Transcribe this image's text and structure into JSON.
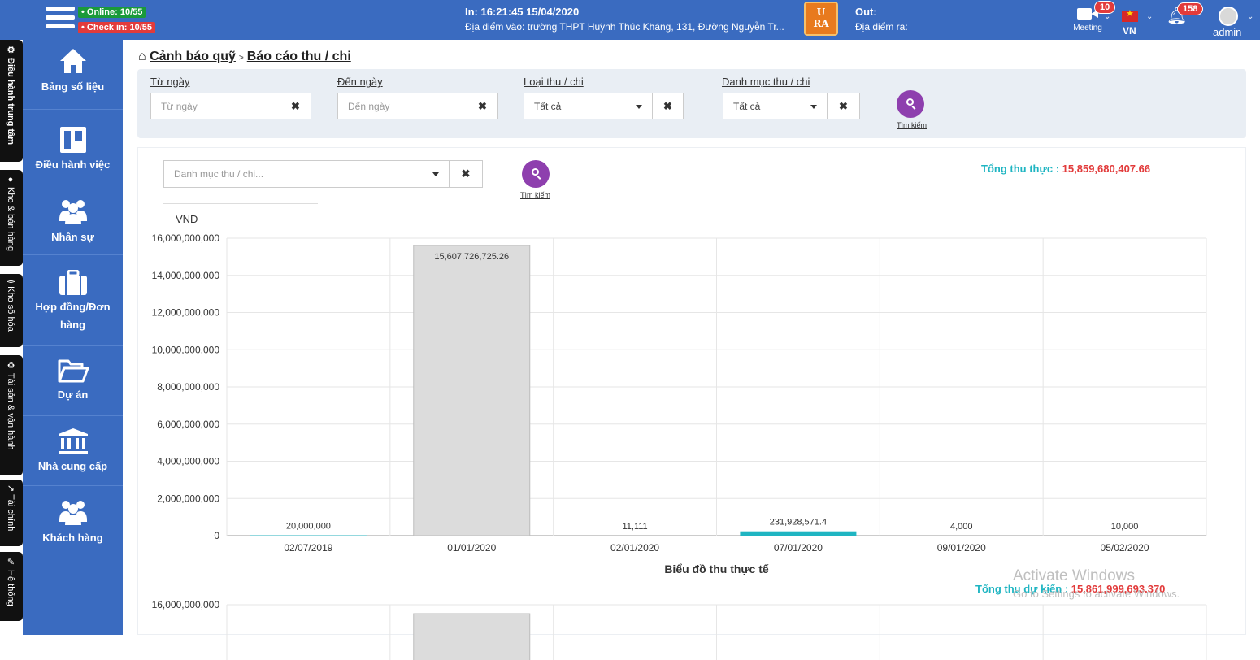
{
  "header": {
    "online": "• Online: 10/55",
    "checkin": "• Check in: 10/55",
    "in_time": "In: 16:21:45 15/04/2020",
    "in_place": "Địa điểm vào: trường THPT Huỳnh Thúc Kháng, 131, Đường Nguyễn Tr...",
    "logo_text_1": "U",
    "logo_text_2": "RA",
    "out_label": "Out:",
    "out_place": "Địa điểm ra:",
    "meeting_label": "Meeting",
    "meeting_badge": "10",
    "lang": "VN",
    "notif_badge": "158",
    "user": "admin",
    "accent": "#3a6bc0"
  },
  "vtabs": [
    {
      "label": "⚙ Điều hành trung tâm",
      "icon": "gear-icon"
    },
    {
      "label": "● Kho & bán hàng",
      "icon": "store-icon"
    },
    {
      "label": "⟫ Kho số hóa",
      "icon": "archive-icon"
    },
    {
      "label": "♻ Tài sản & vận hành",
      "icon": "asset-icon"
    },
    {
      "label": "↗ Tài chính",
      "icon": "finance-icon"
    },
    {
      "label": "✎ Hệ thống",
      "icon": "system-icon"
    }
  ],
  "sidebar": {
    "items": [
      {
        "label": "Bảng số liệu",
        "icon": "home-icon"
      },
      {
        "label": "Điều hành việc",
        "icon": "board-icon"
      },
      {
        "label": "Nhân sự",
        "icon": "users-icon"
      },
      {
        "label": "Hợp đồng/Đơn hàng",
        "label_line1": "Hợp đồng/Đơn",
        "label_line2": "hàng",
        "icon": "briefcase-icon"
      },
      {
        "label": "Dự án",
        "icon": "folder-icon"
      },
      {
        "label": "Nhà cung cấp",
        "icon": "bank-icon"
      },
      {
        "label": "Khách hàng",
        "icon": "customers-icon"
      }
    ]
  },
  "breadcrumb": {
    "parent": "Cảnh báo quỹ",
    "separator": ">",
    "current": "Báo cáo thu / chi"
  },
  "filters": {
    "from_label": "Từ ngày",
    "from_placeholder": "Từ ngày",
    "to_label": "Đến ngày",
    "to_placeholder": "Đến ngày",
    "type_label": "Loại thu / chi",
    "type_value": "Tất cả",
    "category_label": " Danh mục thu / chi",
    "category_value": "Tất cả",
    "clear": "✖",
    "search_label": "Tìm kiếm"
  },
  "panel": {
    "category_placeholder": "Danh mục thu / chi...",
    "clear": "✖",
    "search_label": "Tìm kiếm",
    "total_actual_label": "Tổng thu thực : ",
    "total_actual_value": "15,859,680,407.66",
    "total_expected_label": "Tổng thu dự kiến : ",
    "total_expected_value": "15,861,999,693.370"
  },
  "chart_data": [
    {
      "type": "bar",
      "title": "Biểu đồ thu thực tế",
      "ylabel": "VND",
      "xlabel": "",
      "categories": [
        "02/07/2019",
        "01/01/2020",
        "02/01/2020",
        "07/01/2020",
        "09/01/2020",
        "05/02/2020"
      ],
      "values": [
        20000000,
        15607726725.26,
        11111,
        231928571.4,
        4000,
        10000
      ],
      "value_labels": [
        "20,000,000",
        "15,607,726,725.26",
        "11,111",
        "231,928,571.4",
        "4,000",
        "10,000"
      ],
      "bar_colors": [
        "#1fb5c2",
        "#dcdcdc",
        "#1fb5c2",
        "#1fb5c2",
        "#1fb5c2",
        "#1fb5c2"
      ],
      "ylim": [
        0,
        16000000000
      ],
      "yticks": [
        0,
        2000000000,
        4000000000,
        6000000000,
        8000000000,
        10000000000,
        12000000000,
        14000000000,
        16000000000
      ],
      "ytick_labels": [
        "0",
        "2,000,000,000",
        "4,000,000,000",
        "6,000,000,000",
        "8,000,000,000",
        "10,000,000,000",
        "12,000,000,000",
        "14,000,000,000",
        "16,000,000,000"
      ],
      "grid": true
    },
    {
      "type": "bar",
      "ylim": [
        0,
        16000000000
      ],
      "ytick_labels": [
        "16,000,000,000"
      ],
      "note_visible": "partially visible second chart"
    }
  ],
  "watermark": {
    "line1": "Activate Windows",
    "line2": "Go to Settings to activate Windows."
  }
}
